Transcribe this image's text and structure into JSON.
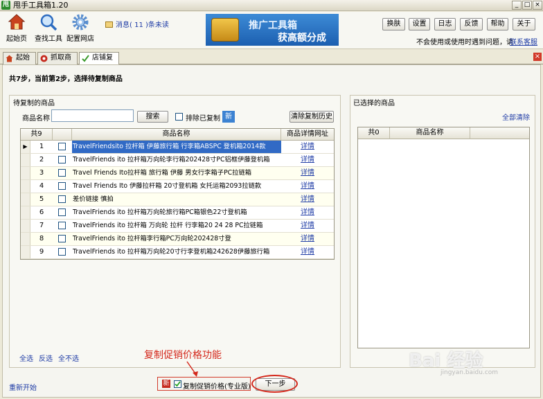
{
  "window": {
    "title": "甩手工具箱1.20",
    "app_icon": "甩",
    "controls": [
      "_",
      "□",
      "×"
    ]
  },
  "toolbar": {
    "buttons": [
      {
        "label": "起始页",
        "icon": "home-icon"
      },
      {
        "label": "查找工具",
        "icon": "magnifier-icon"
      },
      {
        "label": "配置网店",
        "icon": "gear-icon"
      }
    ],
    "message": "消息( 11 )条未读",
    "banner": {
      "line1": "推广工具箱",
      "line2": "获高额分成"
    },
    "right_buttons": [
      "换肤",
      "设置",
      "日志",
      "反馈",
      "帮助",
      "关于"
    ],
    "help_text": "不会使用或使用时遇到问题，请",
    "help_link": "联系客服"
  },
  "tabs": [
    {
      "label": "起始页",
      "icon": "home-icon"
    },
    {
      "label": "抓取商品",
      "icon": "grab-icon"
    },
    {
      "label": "店铺复制",
      "icon": "check-icon",
      "active": true
    }
  ],
  "step_text": "共7步，当前第2步，选择待复制商品",
  "left_panel": {
    "title": "待复制的商品",
    "search_label": "商品名称",
    "search_value": "",
    "search_button": "搜索",
    "exclude_label": "排除已复制",
    "new_badge": "新",
    "clear_history": "清除复制历史",
    "columns": [
      "共9",
      "",
      "商品名称",
      "商品详情网址"
    ],
    "rows": [
      {
        "no": "1",
        "name": "TravelFriendsito 拉杆箱 伊藤旅行箱 行李箱ABSPC 登机箱2014款",
        "link": "详情",
        "selected": true
      },
      {
        "no": "2",
        "name": "TravelFriends ito 拉杆箱万向轮李行箱202428寸PC铝框伊藤登机箱",
        "link": "详情"
      },
      {
        "no": "3",
        "name": "Travel Friends Ito拉杆箱 旅行箱 伊藤 男女行李箱子PC拉链箱",
        "link": "详情"
      },
      {
        "no": "4",
        "name": "Travel Friends Ito 伊藤拉杆箱 20寸登机箱 女托运箱2093拉链款",
        "link": "详情"
      },
      {
        "no": "5",
        "name": "差价链接 慎拍",
        "link": "详情"
      },
      {
        "no": "6",
        "name": "TravelFriends ito 拉杆箱万向轮旅行箱PC箱银色22寸登机箱",
        "link": "详情"
      },
      {
        "no": "7",
        "name": "TravelFriends ito 拉杆箱 万向轮 拉杆 行李箱20 24 28 PC拉链箱",
        "link": "详情"
      },
      {
        "no": "8",
        "name": "TravelFriends ito 拉杆箱李行箱PC万向轮202428寸登",
        "link": "详情"
      },
      {
        "no": "9",
        "name": "TravelFriends ito 拉杆箱万向轮20寸行李登机箱242628伊藤旅行箱",
        "link": "详情"
      }
    ],
    "select_all": "全选",
    "invert": "反选",
    "select_none": "全不选"
  },
  "right_panel": {
    "title": "已选择的商品",
    "clear_all": "全部清除",
    "columns": [
      "共0",
      "商品名称"
    ]
  },
  "footer": {
    "restart": "重新开始",
    "new_badge": "新",
    "promo_label": "复制促销价格(专业版)",
    "next": "下一步",
    "annotation": "复制促销价格功能"
  },
  "watermark": {
    "main": "Bai 经验",
    "sub": "jingyan.baidu.com"
  },
  "colors": {
    "selection": "#316ac5",
    "link": "#1f3ca6",
    "annotation": "#d4281c",
    "banner": "#2a74c4"
  }
}
